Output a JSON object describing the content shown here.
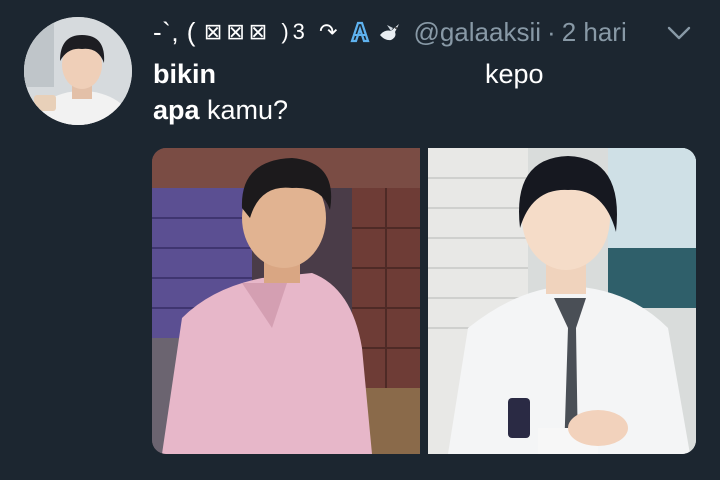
{
  "tweet": {
    "display_name": "-`, ( ",
    "display_name_glyphs": "⊠⊠⊠ )3 ↷",
    "handle": "@galaaksii",
    "separator": "·",
    "time": "2 hari",
    "text_line1_word1": "bikin",
    "text_line1_word2": "kepo",
    "text_line2_word1": "apa",
    "text_line2_word2": " kamu?"
  },
  "icons": {
    "menu": "chevron-down-icon",
    "badge1": "ribbon-icon",
    "badge2": "dove-icon"
  },
  "colors": {
    "background": "#1c2630",
    "secondary_text": "#8899a6",
    "primary_text": "#ffffff"
  }
}
